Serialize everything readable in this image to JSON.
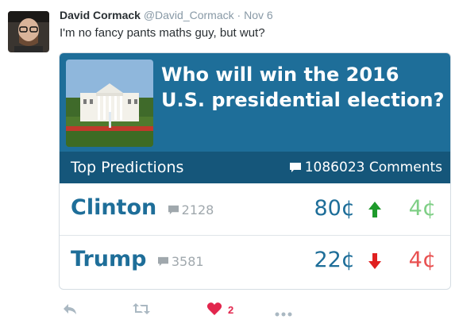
{
  "tweet": {
    "author_name": "David Cormack",
    "handle": "@David_Cormack",
    "date": "· Nov 6",
    "text": "I'm no fancy pants maths guy, but wut?",
    "like_count": "2"
  },
  "card": {
    "question": "Who will win the 2016 U.S. presidential election?",
    "bar_label": "Top Predictions",
    "comments": "1086023 Comments",
    "rows": [
      {
        "name": "Clinton",
        "comment_count": "2128",
        "price": "80¢",
        "change": "4¢",
        "direction": "up"
      },
      {
        "name": "Trump",
        "comment_count": "3581",
        "price": "22¢",
        "change": "4¢",
        "direction": "down"
      }
    ]
  },
  "colors": {
    "card_top": "#1e6e99",
    "card_bar": "#15567a",
    "up_arrow": "#1e9a2b",
    "down_arrow": "#e02020",
    "like": "#e2264d"
  },
  "icons": [
    "avatar",
    "white-house-image",
    "comment-icon",
    "up-arrow-icon",
    "down-arrow-icon",
    "reply-icon",
    "retweet-icon",
    "heart-icon",
    "more-icon"
  ]
}
